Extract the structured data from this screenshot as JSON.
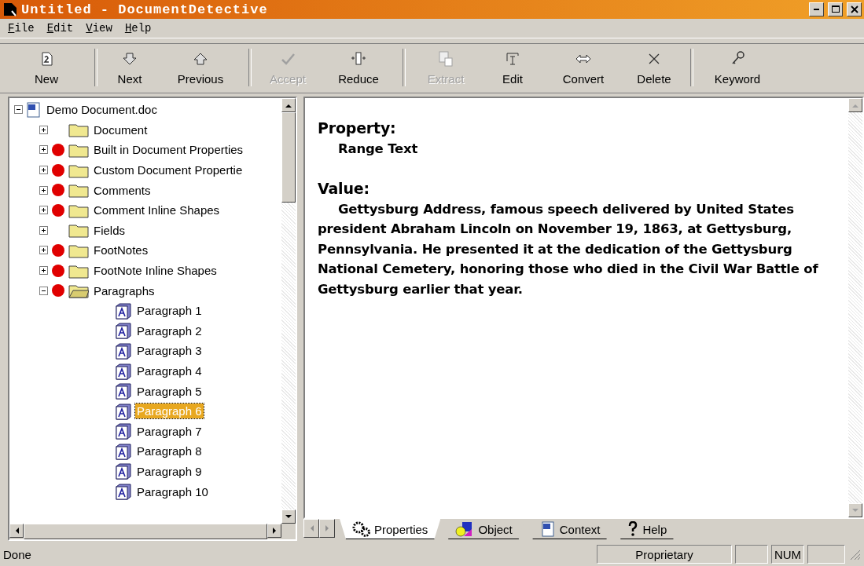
{
  "window": {
    "title": "Untitled - DocumentDetective"
  },
  "menu": [
    "File",
    "Edit",
    "View",
    "Help"
  ],
  "toolbar": [
    {
      "label": "New",
      "disabled": false
    },
    {
      "label": "Next",
      "disabled": false
    },
    {
      "label": "Previous",
      "disabled": false
    },
    {
      "label": "Accept",
      "disabled": true
    },
    {
      "label": "Reduce",
      "disabled": false
    },
    {
      "label": "Extract",
      "disabled": true
    },
    {
      "label": "Edit",
      "disabled": false
    },
    {
      "label": "Convert",
      "disabled": false
    },
    {
      "label": "Delete",
      "disabled": false
    },
    {
      "label": "Keyword",
      "disabled": false
    }
  ],
  "tree": {
    "label": "Demo Document.doc",
    "expanded": true,
    "children": [
      {
        "kind": "folder",
        "label": "Document",
        "flagged": false,
        "expanded": false
      },
      {
        "kind": "folder",
        "label": "Built in Document Properties",
        "flagged": true,
        "expanded": false
      },
      {
        "kind": "folder",
        "label": "Custom Document Propertie",
        "flagged": true,
        "expanded": false
      },
      {
        "kind": "folder",
        "label": "Comments",
        "flagged": true,
        "expanded": false
      },
      {
        "kind": "folder",
        "label": "Comment Inline Shapes",
        "flagged": true,
        "expanded": false
      },
      {
        "kind": "folder",
        "label": "Fields",
        "flagged": false,
        "expanded": false
      },
      {
        "kind": "folder",
        "label": "FootNotes",
        "flagged": true,
        "expanded": false
      },
      {
        "kind": "folder",
        "label": "FootNote Inline Shapes",
        "flagged": true,
        "expanded": false
      },
      {
        "kind": "folder",
        "label": "Paragraphs",
        "flagged": true,
        "expanded": true,
        "children": [
          {
            "kind": "paragraph",
            "label": "Paragraph 1",
            "selected": false
          },
          {
            "kind": "paragraph",
            "label": "Paragraph 2",
            "selected": false
          },
          {
            "kind": "paragraph",
            "label": "Paragraph 3",
            "selected": false
          },
          {
            "kind": "paragraph",
            "label": "Paragraph 4",
            "selected": false
          },
          {
            "kind": "paragraph",
            "label": "Paragraph 5",
            "selected": false
          },
          {
            "kind": "paragraph",
            "label": "Paragraph 6",
            "selected": true
          },
          {
            "kind": "paragraph",
            "label": "Paragraph 7",
            "selected": false
          },
          {
            "kind": "paragraph",
            "label": "Paragraph 8",
            "selected": false
          },
          {
            "kind": "paragraph",
            "label": "Paragraph 9",
            "selected": false
          },
          {
            "kind": "paragraph",
            "label": "Paragraph 10",
            "selected": false
          }
        ]
      }
    ]
  },
  "detail": {
    "property_heading": "Property:",
    "property": "Range Text",
    "value_heading": "Value:",
    "value": "Gettysburg Address, famous speech delivered by United States president Abraham Lincoln on November 19, 1863, at Gettysburg, Pennsylvania. He presented it at the dedication of the Gettysburg National Cemetery, honoring those who died in the Civil War Battle of Gettysburg earlier that year."
  },
  "tabs": [
    {
      "label": "Properties",
      "selected": true
    },
    {
      "label": "Object",
      "selected": false
    },
    {
      "label": "Context",
      "selected": false
    },
    {
      "label": "Help",
      "selected": false
    }
  ],
  "status_bar": {
    "message": "Done",
    "panels": [
      "Proprietary",
      "NUM"
    ]
  }
}
